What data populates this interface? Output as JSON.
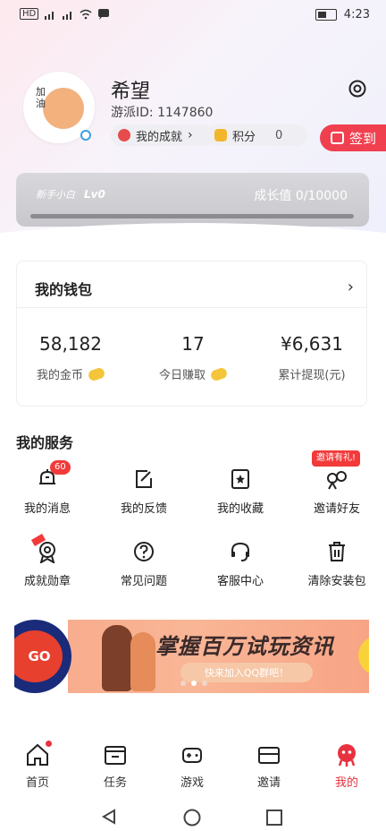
{
  "status_bar": {
    "left_text": "HD",
    "time": "4:23"
  },
  "profile": {
    "avatar_text": "加油",
    "name": "希望",
    "uid": "游派ID: 1147860",
    "achievements_label": "我的成就",
    "points_label": "积分",
    "points_value": "0",
    "checkin_label": "签到"
  },
  "level": {
    "tag": "新手小白",
    "level": "Lv0",
    "growth": "成长值 0/10000",
    "progress": 0
  },
  "wallet": {
    "title": "我的钱包",
    "stats": [
      {
        "value": "58,182",
        "label": "我的金币"
      },
      {
        "value": "17",
        "label": "今日赚取"
      },
      {
        "value": "¥6,631",
        "label": "累计提现(元)"
      }
    ]
  },
  "services": {
    "title": "我的服务",
    "items": [
      {
        "label": "我的消息",
        "icon": "bell-icon",
        "badge": "60"
      },
      {
        "label": "我的反馈",
        "icon": "feedback-icon"
      },
      {
        "label": "我的收藏",
        "icon": "bookmark-icon"
      },
      {
        "label": "邀请好友",
        "icon": "invite-icon",
        "tag": "邀请有礼!"
      },
      {
        "label": "成就勋章",
        "icon": "medal-icon"
      },
      {
        "label": "常见问题",
        "icon": "question-icon"
      },
      {
        "label": "客服中心",
        "icon": "headset-icon"
      },
      {
        "label": "清除安装包",
        "icon": "trash-icon"
      }
    ]
  },
  "banner": {
    "go": "GO",
    "headline": "掌握百万试玩资讯",
    "subline": "快来加入QQ群吧！"
  },
  "tabbar": {
    "items": [
      {
        "label": "首页",
        "icon": "home-icon"
      },
      {
        "label": "任务",
        "icon": "task-icon"
      },
      {
        "label": "游戏",
        "icon": "gamepad-icon"
      },
      {
        "label": "邀请",
        "icon": "envelope-icon"
      },
      {
        "label": "我的",
        "icon": "profile-icon",
        "active": true
      }
    ]
  },
  "colors": {
    "accent": "#f04050",
    "level_card": "#c9c9ce"
  }
}
